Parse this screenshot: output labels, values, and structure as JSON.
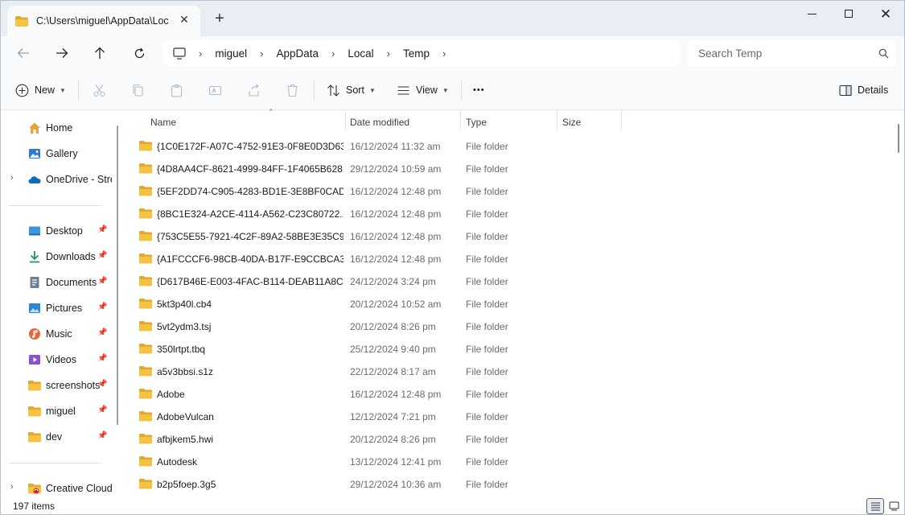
{
  "window": {
    "tab_title": "C:\\Users\\miguel\\AppData\\Loc",
    "icons": {
      "tab_close": "close-icon",
      "new_tab": "plus-icon",
      "minimize": "minimize-icon",
      "maximize": "maximize-icon",
      "close": "close-icon"
    }
  },
  "nav": {
    "back": "back-arrow-icon",
    "forward": "forward-arrow-icon",
    "up": "up-arrow-icon",
    "refresh": "refresh-icon"
  },
  "address": {
    "breadcrumbs": [
      "miguel",
      "AppData",
      "Local",
      "Temp"
    ]
  },
  "search": {
    "placeholder": "Search Temp"
  },
  "toolbar": {
    "new_label": "New",
    "sort_label": "Sort",
    "view_label": "View",
    "more_label": "•••",
    "details_label": "Details"
  },
  "sidebar": {
    "top": [
      {
        "label": "Home",
        "icon": "home-icon"
      },
      {
        "label": "Gallery",
        "icon": "gallery-icon"
      },
      {
        "label": "OneDrive - Stre",
        "icon": "onedrive-icon"
      }
    ],
    "quick": [
      {
        "label": "Desktop",
        "icon": "desktop-icon"
      },
      {
        "label": "Downloads",
        "icon": "downloads-icon"
      },
      {
        "label": "Documents",
        "icon": "documents-icon"
      },
      {
        "label": "Pictures",
        "icon": "pictures-icon"
      },
      {
        "label": "Music",
        "icon": "music-icon"
      },
      {
        "label": "Videos",
        "icon": "videos-icon"
      },
      {
        "label": "screenshots",
        "icon": "folder-icon"
      },
      {
        "label": "miguel",
        "icon": "folder-icon"
      },
      {
        "label": "dev",
        "icon": "folder-icon"
      }
    ],
    "bottom": [
      {
        "label": "Creative Cloud",
        "icon": "creative-cloud-icon"
      }
    ]
  },
  "columns": {
    "name": "Name",
    "date": "Date modified",
    "type": "Type",
    "size": "Size"
  },
  "files": [
    {
      "name": "{1C0E172F-A07C-4752-91E3-0F8E0D3D63...",
      "date": "16/12/2024 11:32 am",
      "type": "File folder"
    },
    {
      "name": "{4D8AA4CF-8621-4999-84FF-1F4065B628...",
      "date": "29/12/2024 10:59 am",
      "type": "File folder"
    },
    {
      "name": "{5EF2DD74-C905-4283-BD1E-3E8BF0CAD...",
      "date": "16/12/2024 12:48 pm",
      "type": "File folder"
    },
    {
      "name": "{8BC1E324-A2CE-4114-A562-C23C80722...",
      "date": "16/12/2024 12:48 pm",
      "type": "File folder"
    },
    {
      "name": "{753C5E55-7921-4C2F-89A2-58BE3E35C9...",
      "date": "16/12/2024 12:48 pm",
      "type": "File folder"
    },
    {
      "name": "{A1FCCCF6-98CB-40DA-B17F-E9CCBCA3...",
      "date": "16/12/2024 12:48 pm",
      "type": "File folder"
    },
    {
      "name": "{D617B46E-E003-4FAC-B114-DEAB11A8C...",
      "date": "24/12/2024 3:24 pm",
      "type": "File folder"
    },
    {
      "name": "5kt3p40l.cb4",
      "date": "20/12/2024 10:52 am",
      "type": "File folder"
    },
    {
      "name": "5vt2ydm3.tsj",
      "date": "20/12/2024 8:26 pm",
      "type": "File folder"
    },
    {
      "name": "350lrtpt.tbq",
      "date": "25/12/2024 9:40 pm",
      "type": "File folder"
    },
    {
      "name": "a5v3bbsi.s1z",
      "date": "22/12/2024 8:17 am",
      "type": "File folder"
    },
    {
      "name": "Adobe",
      "date": "16/12/2024 12:48 pm",
      "type": "File folder"
    },
    {
      "name": "AdobeVulcan",
      "date": "12/12/2024 7:21 pm",
      "type": "File folder"
    },
    {
      "name": "afbjkem5.hwi",
      "date": "20/12/2024 8:26 pm",
      "type": "File folder"
    },
    {
      "name": "Autodesk",
      "date": "13/12/2024 12:41 pm",
      "type": "File folder"
    },
    {
      "name": "b2p5foep.3g5",
      "date": "29/12/2024 10:36 am",
      "type": "File folder"
    }
  ],
  "status": {
    "item_count": "197 items"
  },
  "colors": {
    "folder": "#f5c342",
    "folder_dark": "#e0a82e",
    "titlebar": "#e9eef4",
    "toolbar": "#f8fafc",
    "accent": "#0067c0"
  }
}
